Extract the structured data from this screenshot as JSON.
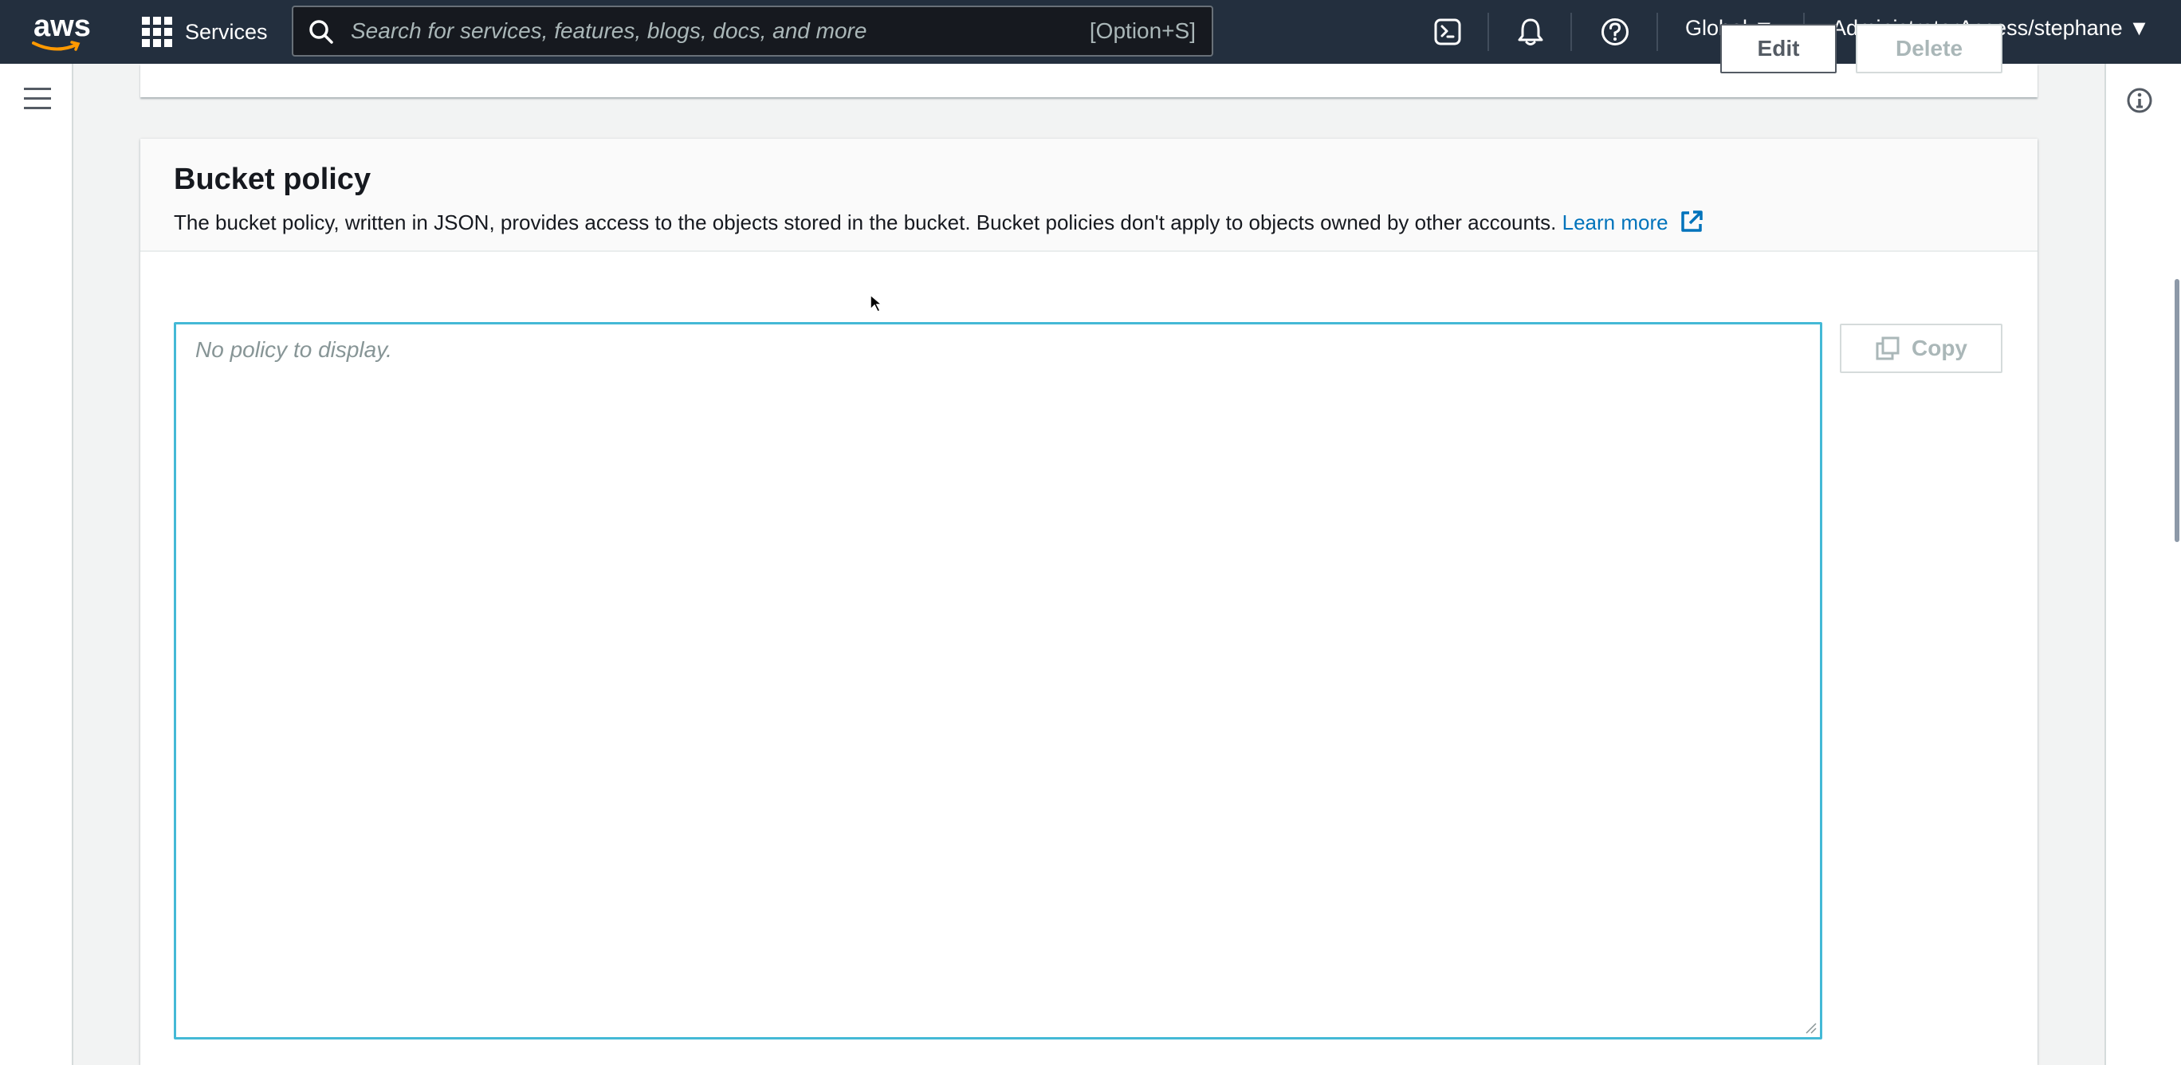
{
  "topnav": {
    "logo_text": "aws",
    "services_label": "Services",
    "search_placeholder": "Search for services, features, blogs, docs, and more",
    "search_shortcut": "[Option+S]",
    "icons": [
      "cloudshell-icon",
      "bell-icon",
      "help-icon"
    ],
    "region_label": "Global ▼",
    "account_label": "AdministratorAccess/stephane ▼"
  },
  "sidebar": {
    "menu_icon": "hamburger-menu-icon"
  },
  "right_panel": {
    "info_icon": "info-icon"
  },
  "bucket_policy": {
    "title": "Bucket policy",
    "description": "The bucket policy, written in JSON, provides access to the objects stored in the bucket. Bucket policies don't apply to objects owned by other accounts.",
    "learn_more": "Learn more",
    "edit_label": "Edit",
    "delete_label": "Delete",
    "copy_label": "Copy",
    "policy_placeholder": "No policy to display."
  },
  "colors": {
    "nav_bg": "#232f3e",
    "link": "#0073bb",
    "focus_border": "#44b9d6",
    "disabled_text": "#aab7b8"
  }
}
